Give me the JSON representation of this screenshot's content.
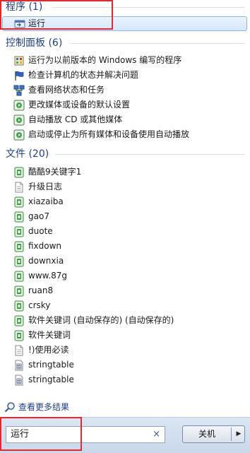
{
  "sections": {
    "programs": {
      "header": "程序 (1)",
      "items": [
        {
          "label": "运行",
          "icon": "run-icon"
        }
      ]
    },
    "control_panel": {
      "header": "控制面板 (6)",
      "items": [
        {
          "label": "运行为以前版本的 Windows 编写的程序",
          "icon": "program-compat-icon"
        },
        {
          "label": "检查计算机的状态并解决问题",
          "icon": "flag-icon"
        },
        {
          "label": "查看网络状态和任务",
          "icon": "network-icon"
        },
        {
          "label": "更改媒体或设备的默认设置",
          "icon": "autoplay-icon"
        },
        {
          "label": "自动播放 CD 或其他媒体",
          "icon": "autoplay-icon"
        },
        {
          "label": "启动或停止为所有媒体和设备使用自动播放",
          "icon": "autoplay-icon"
        }
      ]
    },
    "files": {
      "header": "文件 (20)",
      "items": [
        {
          "label": "酷酷9关键字1",
          "icon": "text-file-icon"
        },
        {
          "label": "升级日志",
          "icon": "document-icon"
        },
        {
          "label": "xiazaiba",
          "icon": "text-file-icon"
        },
        {
          "label": "gao7",
          "icon": "text-file-icon"
        },
        {
          "label": "duote",
          "icon": "text-file-icon"
        },
        {
          "label": "fixdown",
          "icon": "text-file-icon"
        },
        {
          "label": "downxia",
          "icon": "text-file-icon"
        },
        {
          "label": "www.87g",
          "icon": "text-file-icon"
        },
        {
          "label": "ruan8",
          "icon": "text-file-icon"
        },
        {
          "label": "crsky",
          "icon": "text-file-icon"
        },
        {
          "label": "软件关键词 (自动保存的) (自动保存的)",
          "icon": "text-file-icon"
        },
        {
          "label": "软件关键词",
          "icon": "text-file-icon"
        },
        {
          "label": "!)使用必读",
          "icon": "document-icon"
        },
        {
          "label": "stringtable",
          "icon": "table-file-icon"
        },
        {
          "label": "stringtable",
          "icon": "table-file-icon"
        }
      ]
    }
  },
  "see_more": {
    "label": "查看更多结果"
  },
  "search": {
    "value": "运行",
    "clear_symbol": "×"
  },
  "shutdown": {
    "label": "关机",
    "arrow": "▶"
  },
  "colors": {
    "header_text": "#1e3e8e",
    "highlight_border": "#e8262d",
    "selection": "#d5e7fb"
  }
}
